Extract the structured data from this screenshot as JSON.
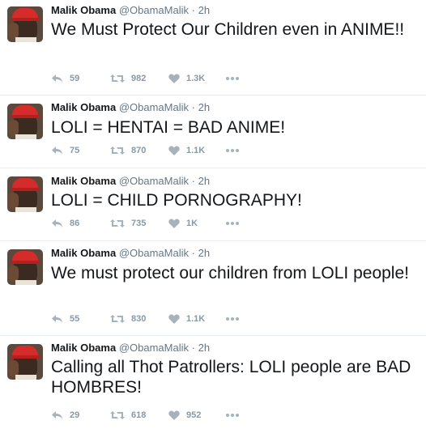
{
  "tweets": [
    {
      "author_name": "Malik Obama",
      "author_handle": "@ObamaMalik",
      "separator": "·",
      "time": "2h",
      "text": "We Must Protect Our Children even in ANIME!!",
      "replies": "59",
      "retweets": "982",
      "likes": "1.3K"
    },
    {
      "author_name": "Malik Obama",
      "author_handle": "@ObamaMalik",
      "separator": "·",
      "time": "2h",
      "text": "LOLI = HENTAI = BAD ANIME!",
      "replies": "75",
      "retweets": "870",
      "likes": "1.1K"
    },
    {
      "author_name": "Malik Obama",
      "author_handle": "@ObamaMalik",
      "separator": "·",
      "time": "2h",
      "text": "LOLI = CHILD PORNOGRAPHY!",
      "replies": "86",
      "retweets": "735",
      "likes": "1K"
    },
    {
      "author_name": "Malik Obama",
      "author_handle": "@ObamaMalik",
      "separator": "·",
      "time": "2h",
      "text": "We must protect our children from LOLI people!",
      "replies": "55",
      "retweets": "830",
      "likes": "1.1K"
    },
    {
      "author_name": "Malik Obama",
      "author_handle": "@ObamaMalik",
      "separator": "·",
      "time": "2h",
      "text": "Calling all Thot Patrollers: LOLI people are BAD HOMBRES!",
      "replies": "29",
      "retweets": "618",
      "likes": "952"
    }
  ],
  "icons": {
    "reply": "reply-icon",
    "retweet": "retweet-icon",
    "like": "heart-icon",
    "more": "more-dots-icon"
  },
  "colors": {
    "text": "#14171a",
    "secondary": "#657786",
    "action": "#8899a6",
    "divider": "#e6ecf0",
    "hat": "#d62b2b"
  }
}
